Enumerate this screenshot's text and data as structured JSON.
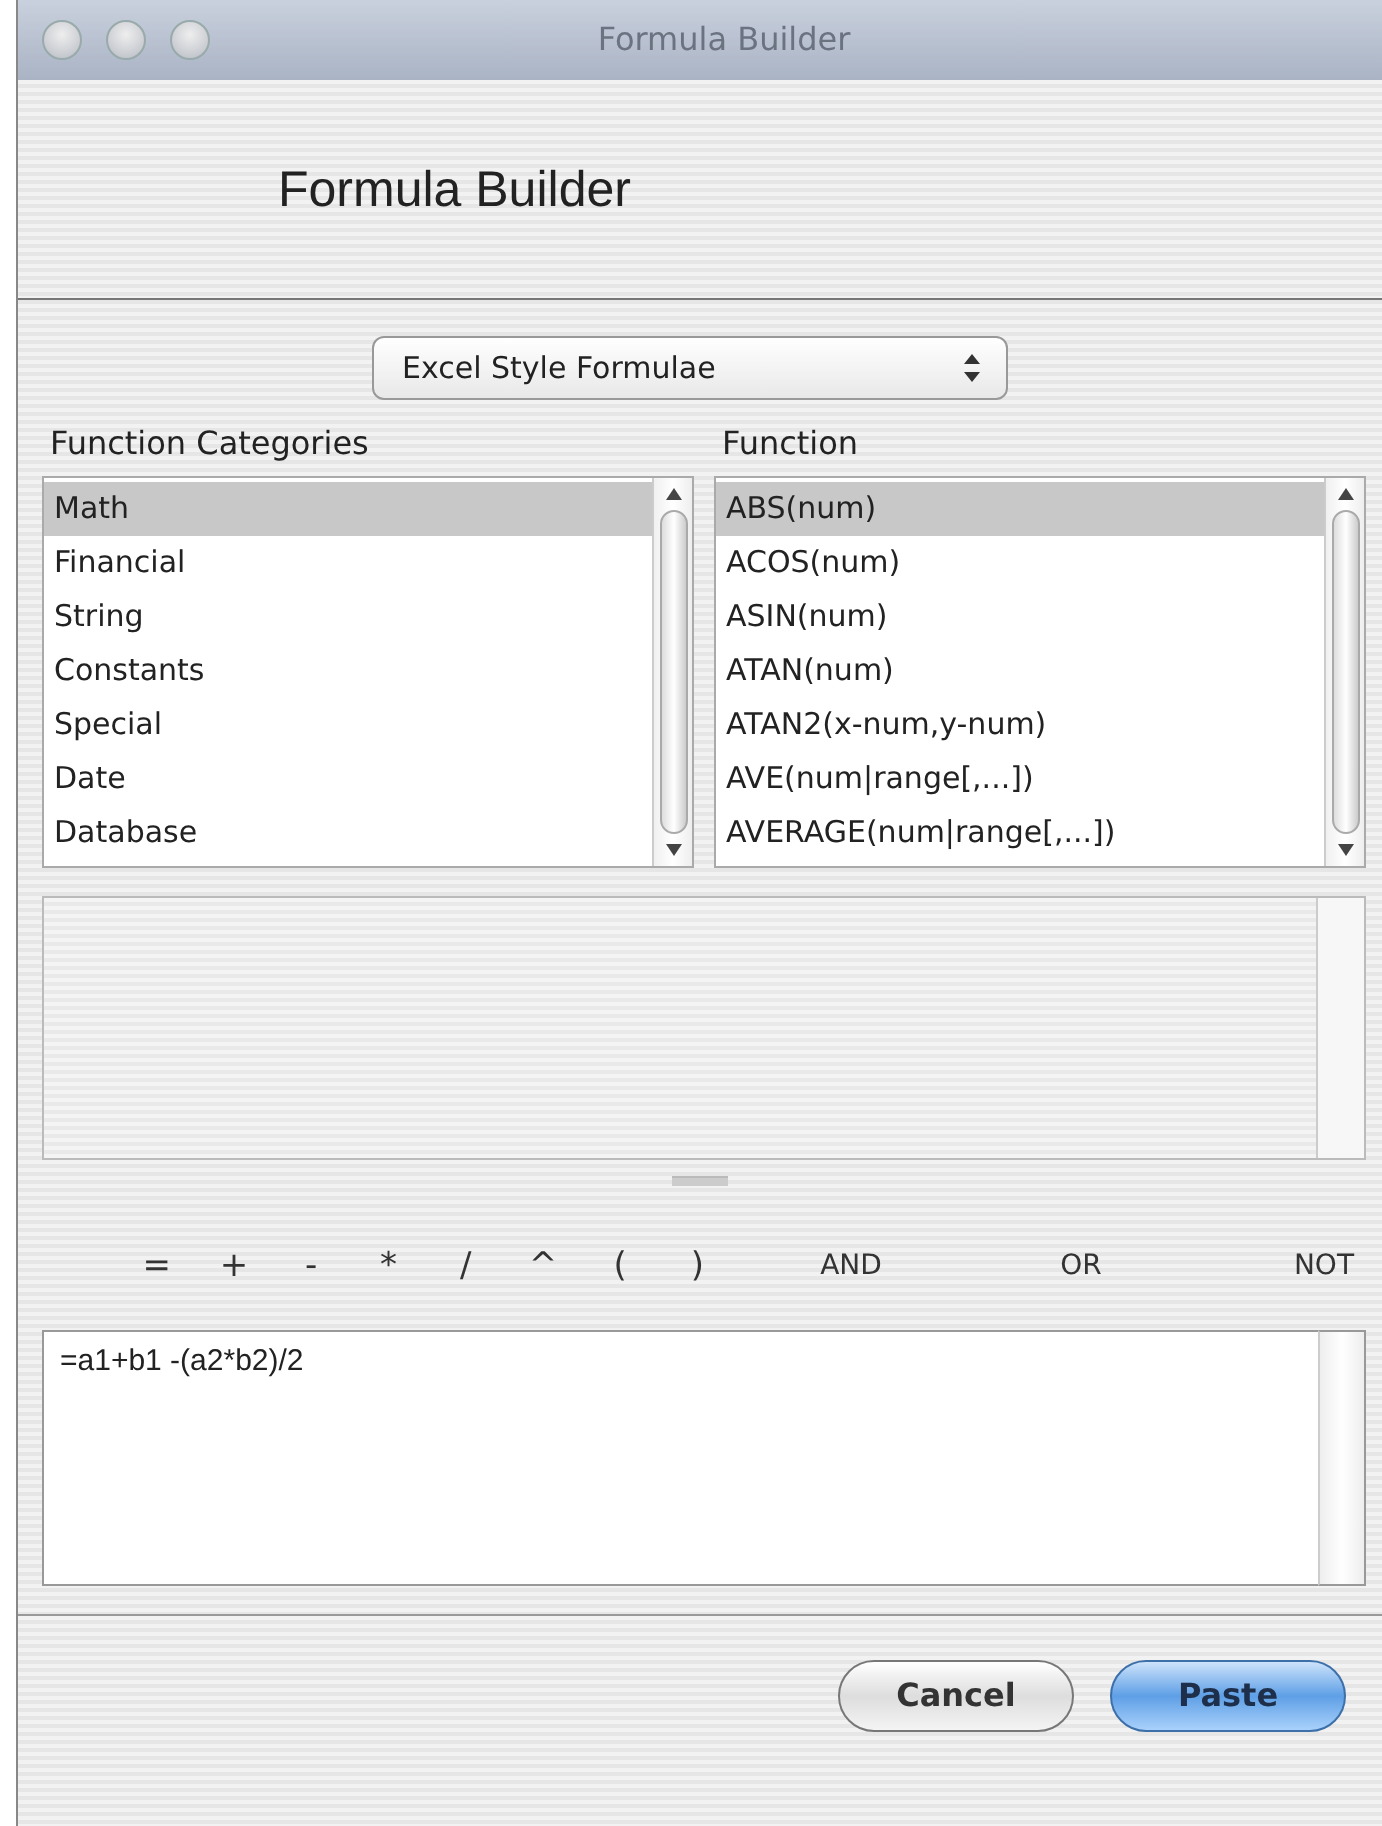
{
  "window": {
    "title": "Formula Builder"
  },
  "heading": "Formula Builder",
  "style_menu": {
    "value": "Excel Style Formulae"
  },
  "categories": {
    "label": "Function Categories",
    "items": [
      {
        "label": "Math",
        "selected": true
      },
      {
        "label": "Financial",
        "selected": false
      },
      {
        "label": "String",
        "selected": false
      },
      {
        "label": "Constants",
        "selected": false
      },
      {
        "label": "Special",
        "selected": false
      },
      {
        "label": "Date",
        "selected": false
      },
      {
        "label": "Database",
        "selected": false
      }
    ]
  },
  "functions": {
    "label": "Function",
    "items": [
      {
        "label": "ABS(num)",
        "selected": true
      },
      {
        "label": "ACOS(num)",
        "selected": false
      },
      {
        "label": "ASIN(num)",
        "selected": false
      },
      {
        "label": "ATAN(num)",
        "selected": false
      },
      {
        "label": "ATAN2(x-num,y-num)",
        "selected": false
      },
      {
        "label": "AVE(num|range[,...])",
        "selected": false
      },
      {
        "label": "AVERAGE(num|range[,...])",
        "selected": false
      }
    ]
  },
  "operators": [
    "=",
    "+",
    "-",
    "*",
    "/",
    "^",
    "(",
    ")"
  ],
  "logic_operators": [
    "AND",
    "OR",
    "NOT"
  ],
  "formula": {
    "value": "=a1+b1 -(a2*b2)/2"
  },
  "buttons": [
    {
      "label": "Cancel",
      "kind": "normal"
    },
    {
      "label": "Paste",
      "kind": "default"
    }
  ]
}
